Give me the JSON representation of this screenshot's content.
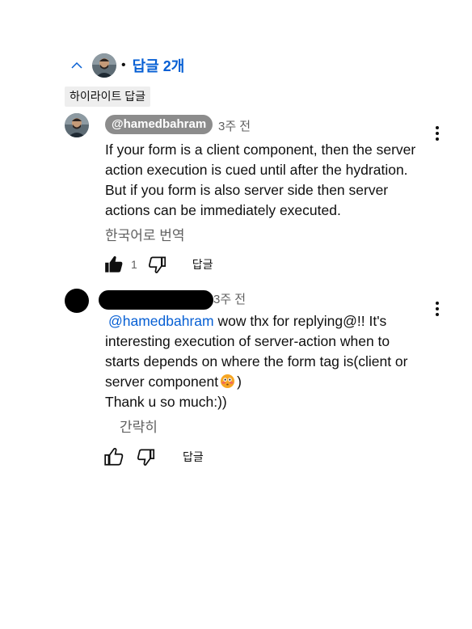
{
  "replies_toggle": {
    "label": "답글 2개"
  },
  "highlight_badge": "하이라이트 답글",
  "reply1": {
    "author": "@hamedbahram",
    "time": "3주 전",
    "text_lines": [
      "If your form is a client component, then the server",
      "action execution is cued until after the hydration.",
      "But if you form is also server side then server",
      "actions can be immediately executed."
    ],
    "translate_label": "한국어로 번역",
    "like_count": "1",
    "reply_label": "답글"
  },
  "reply2": {
    "time": "3주 전",
    "mention": "@hamedbahram",
    "text_line1": " wow thx for replying@!! It's",
    "text_lines": [
      "interesting execution of server-action when to",
      "starts depends on where the form tag is(client or"
    ],
    "text_line4": "server component",
    "text_line4_end": ")",
    "text_line5": "Thank u so much:))",
    "collapse_label": "간략히",
    "reply_label": "답글"
  },
  "colors": {
    "link": "#065fd4",
    "muted": "#606060",
    "chip": "#8c8c8c"
  }
}
